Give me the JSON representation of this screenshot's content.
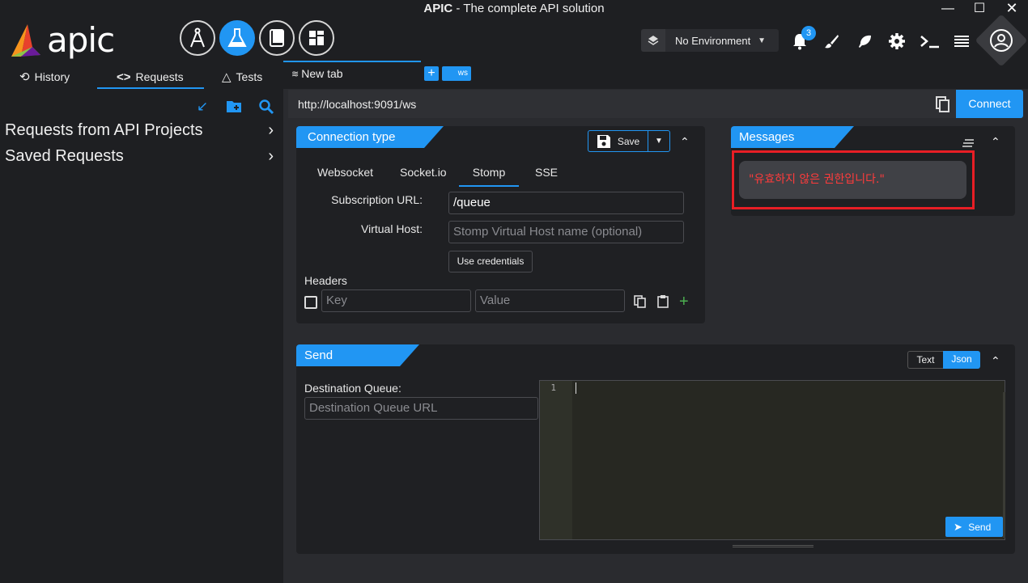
{
  "window": {
    "title_bold": "APIC",
    "title_rest": " - The complete API solution"
  },
  "logo": {
    "text": "apic"
  },
  "modes": [
    {
      "name": "designer",
      "icon": "compass-icon"
    },
    {
      "name": "tester",
      "icon": "flask-icon"
    },
    {
      "name": "docs",
      "icon": "book-icon"
    },
    {
      "name": "dashboard",
      "icon": "grid-icon"
    }
  ],
  "toolbar": {
    "environment": "No Environment",
    "notification_count": "3"
  },
  "nav": {
    "history": "History",
    "requests": "Requests",
    "tests": "Tests"
  },
  "tabs": {
    "current": "New tab",
    "ws_label": "ws"
  },
  "sidebar": {
    "items": [
      {
        "label": "Requests from API Projects"
      },
      {
        "label": "Saved Requests"
      }
    ]
  },
  "request": {
    "url": "http://localhost:9091/ws",
    "connect_label": "Connect"
  },
  "connection": {
    "title": "Connection type",
    "save_label": "Save",
    "tabs": [
      "Websocket",
      "Socket.io",
      "Stomp",
      "SSE"
    ],
    "active_tab": "Stomp",
    "subscription_label": "Subscription URL:",
    "subscription_value": "/queue",
    "vhost_label": "Virtual Host:",
    "vhost_placeholder": "Stomp Virtual Host name (optional)",
    "credentials_label": "Use credentials",
    "headers_label": "Headers",
    "key_placeholder": "Key",
    "value_placeholder": "Value"
  },
  "messages": {
    "title": "Messages",
    "items": [
      "\"유효하지 않은 권한입니다.\""
    ]
  },
  "send": {
    "title": "Send",
    "text_label": "Text",
    "json_label": "Json",
    "active_format": "Json",
    "dest_label": "Destination Queue:",
    "dest_placeholder": "Destination Queue URL",
    "line_number": "1",
    "send_label": "Send"
  },
  "colors": {
    "accent": "#2196f3",
    "error_text": "#ff3b3b",
    "highlight_frame": "#e81e25"
  }
}
